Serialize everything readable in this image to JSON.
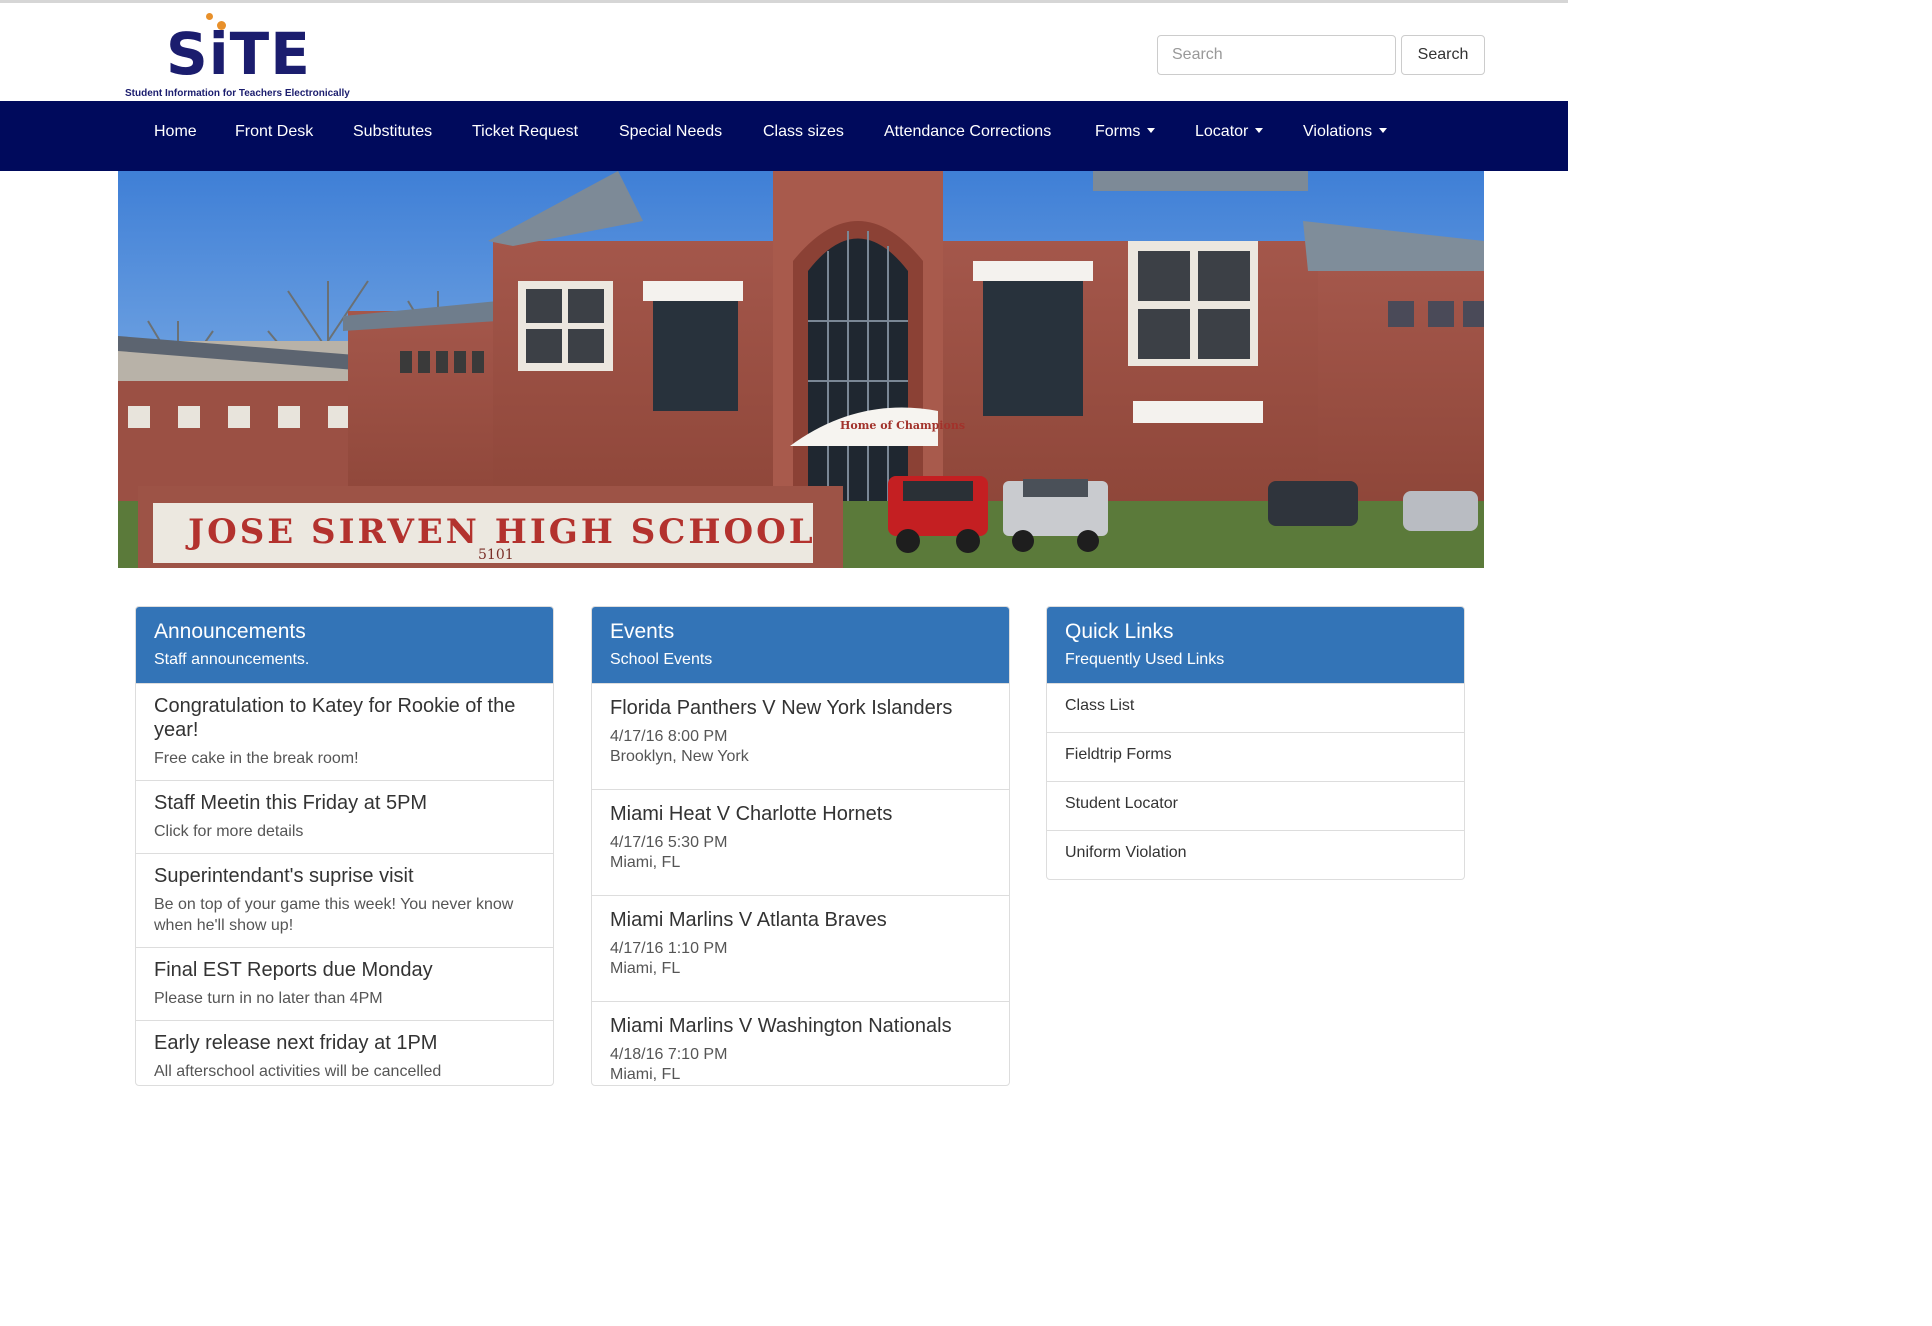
{
  "brand": {
    "logo_word": "SiTE",
    "tagline": "Student Information for Teachers Electronically"
  },
  "search": {
    "placeholder": "Search",
    "button_label": "Search"
  },
  "nav": {
    "items": [
      {
        "label": "Home"
      },
      {
        "label": "Front Desk"
      },
      {
        "label": "Substitutes"
      },
      {
        "label": "Ticket Request"
      },
      {
        "label": "Special Needs"
      },
      {
        "label": "Class sizes"
      },
      {
        "label": "Attendance Corrections"
      },
      {
        "label": "Forms"
      },
      {
        "label": "Locator"
      },
      {
        "label": "Violations"
      }
    ]
  },
  "hero": {
    "sign_text": "JOSE SIRVEN  HIGH  SCHOOL",
    "sign_number": "5101",
    "banner_text": "Home of Champions"
  },
  "announcements": {
    "title": "Announcements",
    "subtitle": "Staff announcements.",
    "items": [
      {
        "title": "Congratulation to Katey for Rookie of the year!",
        "text": "Free cake in the break room!"
      },
      {
        "title": "Staff Meetin this Friday at 5PM",
        "text": "Click for more details"
      },
      {
        "title": "Superintendant's suprise visit",
        "text": "Be on top of your game this week! You never know when he'll show up!"
      },
      {
        "title": "Final EST Reports due Monday",
        "text": "Please turn in no later than 4PM"
      },
      {
        "title": "Early release next friday at 1PM",
        "text": "All afterschool activities will be cancelled"
      }
    ]
  },
  "events": {
    "title": "Events",
    "subtitle": "School Events",
    "items": [
      {
        "title": "Florida Panthers V New York Islanders",
        "date": "4/17/16 8:00 PM",
        "location": "Brooklyn, New York"
      },
      {
        "title": "Miami Heat V Charlotte Hornets",
        "date": "4/17/16 5:30 PM",
        "location": "Miami, FL"
      },
      {
        "title": "Miami Marlins V Atlanta Braves",
        "date": "4/17/16 1:10 PM",
        "location": "Miami, FL"
      },
      {
        "title": "Miami Marlins V Washington Nationals",
        "date": "4/18/16 7:10 PM",
        "location": "Miami, FL"
      }
    ]
  },
  "quick_links": {
    "title": "Quick Links",
    "subtitle": "Frequently Used Links",
    "items": [
      {
        "label": "Class List"
      },
      {
        "label": "Fieldtrip Forms"
      },
      {
        "label": "Student Locator"
      },
      {
        "label": "Uniform Violation"
      }
    ]
  },
  "colors": {
    "navbar": "#000a5c",
    "panel_header": "#3374b7",
    "logo": "#1b1d6e",
    "logo_accent": "#e8902a"
  }
}
